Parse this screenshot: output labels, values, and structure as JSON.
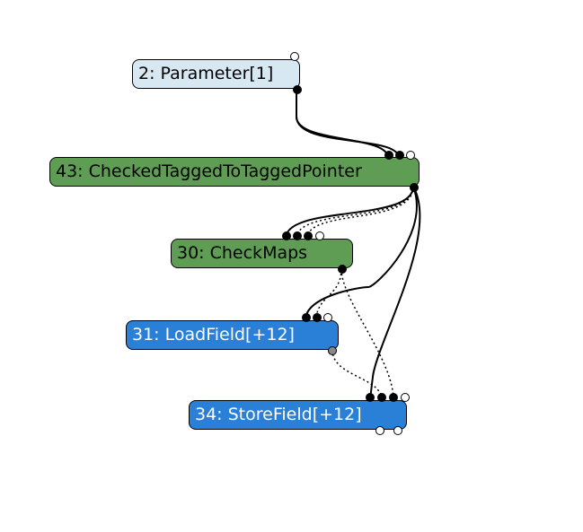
{
  "nodes": {
    "n2": {
      "id": 2,
      "label": "2: Parameter[1]",
      "op": "Parameter",
      "args": "[1]"
    },
    "n43": {
      "id": 43,
      "label": "43: CheckedTaggedToTaggedPointer",
      "op": "CheckedTaggedToTaggedPointer",
      "args": ""
    },
    "n30": {
      "id": 30,
      "label": "30: CheckMaps",
      "op": "CheckMaps",
      "args": ""
    },
    "n31": {
      "id": 31,
      "label": "31: LoadField[+12]",
      "op": "LoadField",
      "args": "[+12]"
    },
    "n34": {
      "id": 34,
      "label": "34: StoreField[+12]",
      "op": "StoreField",
      "args": "[+12]"
    }
  },
  "edges": [
    {
      "from": "n2",
      "to": "n43",
      "kind": "value"
    },
    {
      "from": "n2",
      "to": "n43",
      "kind": "value"
    },
    {
      "from": "n43",
      "to": "n30",
      "kind": "value"
    },
    {
      "from": "n43",
      "to": "n30",
      "kind": "effect"
    },
    {
      "from": "n43",
      "to": "n30",
      "kind": "effect"
    },
    {
      "from": "n43",
      "to": "n31",
      "kind": "value"
    },
    {
      "from": "n30",
      "to": "n31",
      "kind": "effect"
    },
    {
      "from": "n43",
      "to": "n34",
      "kind": "value"
    },
    {
      "from": "n31",
      "to": "n34",
      "kind": "effect"
    },
    {
      "from": "n30",
      "to": "n34",
      "kind": "effect"
    }
  ]
}
